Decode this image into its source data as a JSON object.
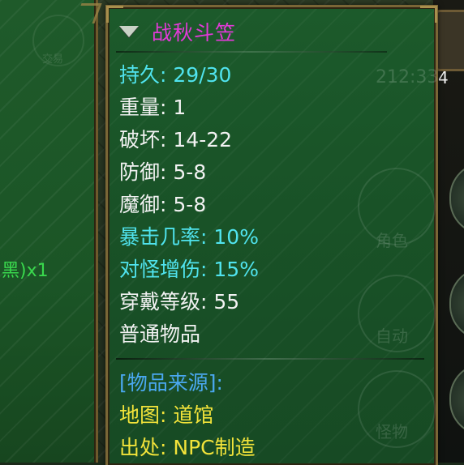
{
  "background": {
    "left_panel_item_text": "黑)x1",
    "right_hud_digit": "4",
    "ghost_time": "212:33",
    "ghost_button_labels": [
      "角色",
      "自动",
      "怪物"
    ],
    "ghost_left_label": "交易"
  },
  "tooltip": {
    "item_name": "战秋斗笠",
    "stats": [
      {
        "label": "持久",
        "value": "29/30",
        "color": "cyan"
      },
      {
        "label": "重量",
        "value": "1",
        "color": "white"
      },
      {
        "label": "破坏",
        "value": "14-22",
        "color": "white"
      },
      {
        "label": "防御",
        "value": "5-8",
        "color": "white"
      },
      {
        "label": "魔御",
        "value": "5-8",
        "color": "white"
      },
      {
        "label": "暴击几率",
        "value": "10%",
        "color": "cyan"
      },
      {
        "label": "对怪增伤",
        "value": "15%",
        "color": "cyan"
      },
      {
        "label": "穿戴等级",
        "value": "55",
        "color": "white"
      },
      {
        "label": "普通物品",
        "value": null,
        "color": "white"
      }
    ],
    "source_header": "[物品来源]:",
    "map": {
      "label": "地图",
      "value": "道馆"
    },
    "origin": {
      "label": "出处",
      "value": "NPC制造"
    }
  },
  "colors": {
    "item_name": "#e23ad8",
    "stat_cyan": "#50e3ee",
    "stat_white": "#f2f2f2",
    "source_header": "#4aa8f0",
    "source_text": "#f2e33a",
    "panel_green": "#1b5526",
    "frame_gold": "#7a6636"
  },
  "icons": [
    "collapse-triangle-icon"
  ]
}
